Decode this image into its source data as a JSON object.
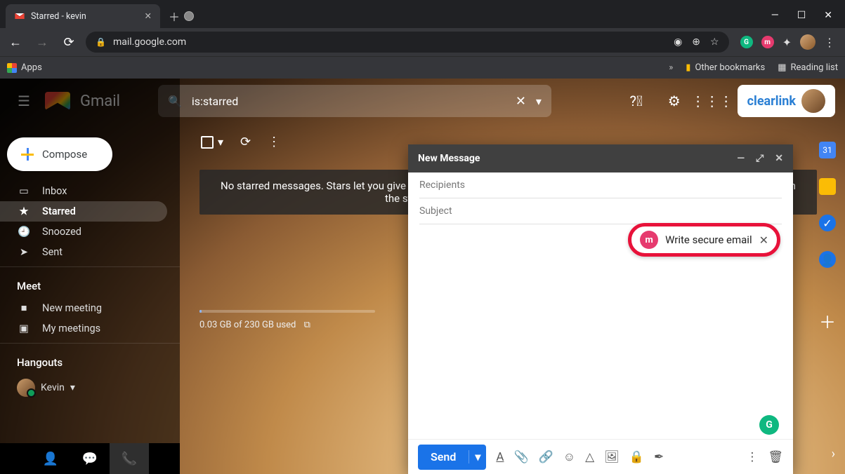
{
  "browser": {
    "tab_title": "Starred - kevin",
    "url": "mail.google.com",
    "bookmarks_apps": "Apps",
    "other_bookmarks": "Other bookmarks",
    "reading_list": "Reading list"
  },
  "header": {
    "product": "Gmail",
    "search_value": "is:starred",
    "brand": "clearlink"
  },
  "sidebar": {
    "compose": "Compose",
    "items": [
      {
        "label": "Inbox"
      },
      {
        "label": "Starred"
      },
      {
        "label": "Snoozed"
      },
      {
        "label": "Sent"
      }
    ],
    "meet_label": "Meet",
    "meet_items": [
      {
        "label": "New meeting"
      },
      {
        "label": "My meetings"
      }
    ],
    "hangouts_label": "Hangouts",
    "user_name": "Kevin"
  },
  "content": {
    "empty_message": "No starred messages. Stars let you give messages a special status to make them easier to find. To star a message, click on the star outline beside any message or conversation.",
    "storage_text": "0.03 GB of 230 GB used"
  },
  "composer": {
    "title": "New Message",
    "recipients_placeholder": "Recipients",
    "subject_placeholder": "Subject",
    "send_label": "Send",
    "secure_label": "Write secure email"
  }
}
